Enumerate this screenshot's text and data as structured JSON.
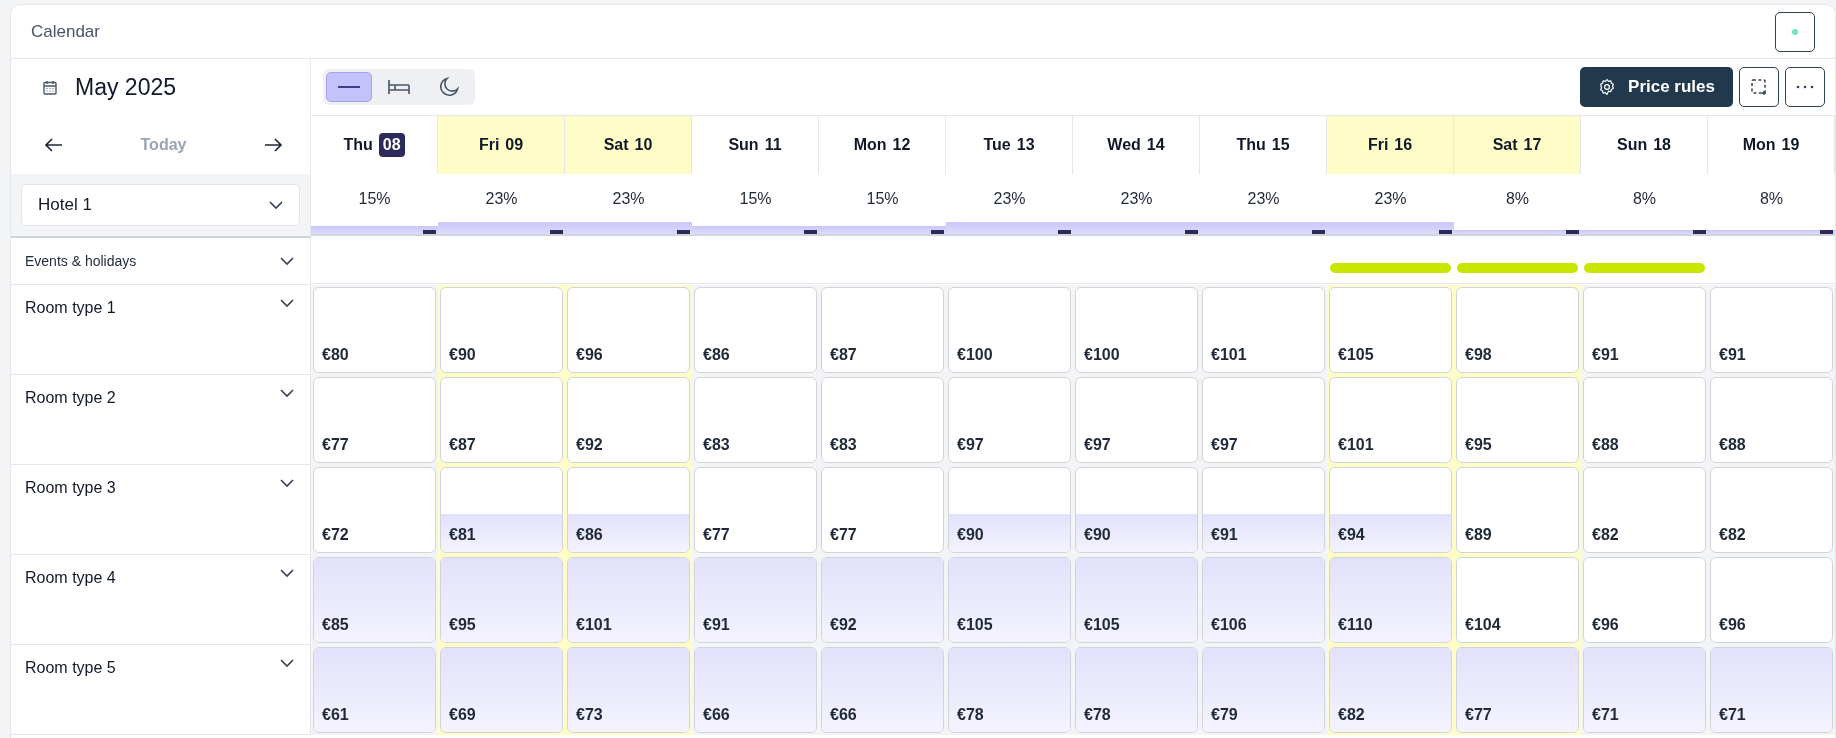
{
  "header": {
    "title": "Calendar"
  },
  "month": "May 2025",
  "today_button": {
    "label": "Today",
    "disabled": true
  },
  "hotel_select": {
    "value": "Hotel 1"
  },
  "view_modes": [
    {
      "kind": "line",
      "selected": true
    },
    {
      "kind": "bed",
      "selected": false
    },
    {
      "kind": "moon",
      "selected": false
    }
  ],
  "price_rules_button": "Price rules",
  "days": [
    {
      "weekday": "Thu",
      "date": "08",
      "today": true,
      "highlighted": false,
      "occupancy": "15%",
      "kind": "medium",
      "event": false
    },
    {
      "weekday": "Fri",
      "date": "09",
      "today": false,
      "highlighted": true,
      "occupancy": "23%",
      "kind": "high",
      "event": false
    },
    {
      "weekday": "Sat",
      "date": "10",
      "today": false,
      "highlighted": true,
      "occupancy": "23%",
      "kind": "high",
      "event": false
    },
    {
      "weekday": "Sun",
      "date": "11",
      "today": false,
      "highlighted": false,
      "occupancy": "15%",
      "kind": "medium",
      "event": false
    },
    {
      "weekday": "Mon",
      "date": "12",
      "today": false,
      "highlighted": false,
      "occupancy": "15%",
      "kind": "medium",
      "event": false
    },
    {
      "weekday": "Tue",
      "date": "13",
      "today": false,
      "highlighted": false,
      "occupancy": "23%",
      "kind": "high",
      "event": false
    },
    {
      "weekday": "Wed",
      "date": "14",
      "today": false,
      "highlighted": false,
      "occupancy": "23%",
      "kind": "high",
      "event": false
    },
    {
      "weekday": "Thu",
      "date": "15",
      "today": false,
      "highlighted": false,
      "occupancy": "23%",
      "kind": "high",
      "event": false
    },
    {
      "weekday": "Fri",
      "date": "16",
      "today": false,
      "highlighted": true,
      "occupancy": "23%",
      "kind": "high",
      "event": true
    },
    {
      "weekday": "Sat",
      "date": "17",
      "today": false,
      "highlighted": true,
      "occupancy": "8%",
      "kind": "low",
      "event": true
    },
    {
      "weekday": "Sun",
      "date": "18",
      "today": false,
      "highlighted": false,
      "occupancy": "8%",
      "kind": "low",
      "event": true
    },
    {
      "weekday": "Mon",
      "date": "19",
      "today": false,
      "highlighted": false,
      "occupancy": "8%",
      "kind": "low",
      "event": false
    }
  ],
  "events_label": "Events & holidays",
  "room_types": [
    {
      "name": "Room type 1",
      "cells": [
        {
          "price": "€80",
          "kind": "none"
        },
        {
          "price": "€90",
          "kind": "none"
        },
        {
          "price": "€96",
          "kind": "none"
        },
        {
          "price": "€86",
          "kind": "none"
        },
        {
          "price": "€87",
          "kind": "none"
        },
        {
          "price": "€100",
          "kind": "none"
        },
        {
          "price": "€100",
          "kind": "none"
        },
        {
          "price": "€101",
          "kind": "none"
        },
        {
          "price": "€105",
          "kind": "none"
        },
        {
          "price": "€98",
          "kind": "none"
        },
        {
          "price": "€91",
          "kind": "none"
        },
        {
          "price": "€91",
          "kind": "none"
        }
      ]
    },
    {
      "name": "Room type 2",
      "cells": [
        {
          "price": "€77",
          "kind": "none"
        },
        {
          "price": "€87",
          "kind": "none"
        },
        {
          "price": "€92",
          "kind": "none"
        },
        {
          "price": "€83",
          "kind": "none"
        },
        {
          "price": "€83",
          "kind": "none"
        },
        {
          "price": "€97",
          "kind": "none"
        },
        {
          "price": "€97",
          "kind": "none"
        },
        {
          "price": "€97",
          "kind": "none"
        },
        {
          "price": "€101",
          "kind": "none"
        },
        {
          "price": "€95",
          "kind": "none"
        },
        {
          "price": "€88",
          "kind": "none"
        },
        {
          "price": "€88",
          "kind": "none"
        }
      ]
    },
    {
      "name": "Room type 3",
      "cells": [
        {
          "price": "€72",
          "kind": "none"
        },
        {
          "price": "€81",
          "kind": "half"
        },
        {
          "price": "€86",
          "kind": "half"
        },
        {
          "price": "€77",
          "kind": "none"
        },
        {
          "price": "€77",
          "kind": "none"
        },
        {
          "price": "€90",
          "kind": "half"
        },
        {
          "price": "€90",
          "kind": "half"
        },
        {
          "price": "€91",
          "kind": "half"
        },
        {
          "price": "€94",
          "kind": "half"
        },
        {
          "price": "€89",
          "kind": "none"
        },
        {
          "price": "€82",
          "kind": "none"
        },
        {
          "price": "€82",
          "kind": "none"
        }
      ]
    },
    {
      "name": "Room type 4",
      "cells": [
        {
          "price": "€85",
          "kind": "full"
        },
        {
          "price": "€95",
          "kind": "full"
        },
        {
          "price": "€101",
          "kind": "full"
        },
        {
          "price": "€91",
          "kind": "full"
        },
        {
          "price": "€92",
          "kind": "full"
        },
        {
          "price": "€105",
          "kind": "full"
        },
        {
          "price": "€105",
          "kind": "full"
        },
        {
          "price": "€106",
          "kind": "full"
        },
        {
          "price": "€110",
          "kind": "full"
        },
        {
          "price": "€104",
          "kind": "none"
        },
        {
          "price": "€96",
          "kind": "none"
        },
        {
          "price": "€96",
          "kind": "none"
        }
      ]
    },
    {
      "name": "Room type 5",
      "cells": [
        {
          "price": "€61",
          "kind": "full"
        },
        {
          "price": "€69",
          "kind": "full"
        },
        {
          "price": "€73",
          "kind": "full"
        },
        {
          "price": "€66",
          "kind": "full"
        },
        {
          "price": "€66",
          "kind": "full"
        },
        {
          "price": "€78",
          "kind": "full"
        },
        {
          "price": "€78",
          "kind": "full"
        },
        {
          "price": "€79",
          "kind": "full"
        },
        {
          "price": "€82",
          "kind": "full"
        },
        {
          "price": "€77",
          "kind": "full"
        },
        {
          "price": "€71",
          "kind": "full"
        },
        {
          "price": "€71",
          "kind": "full"
        }
      ]
    }
  ]
}
